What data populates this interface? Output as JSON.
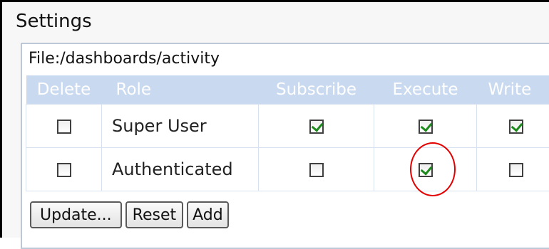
{
  "panel": {
    "title": "Settings"
  },
  "file_path": "File:/dashboards/activity",
  "table": {
    "headers": {
      "delete": "Delete",
      "role": "Role",
      "subscribe": "Subscribe",
      "execute": "Execute",
      "write": "Write"
    },
    "rows": [
      {
        "delete": false,
        "role": "Super User",
        "subscribe": true,
        "execute": true,
        "write": true
      },
      {
        "delete": false,
        "role": "Authenticated",
        "subscribe": false,
        "execute": true,
        "write": false
      }
    ]
  },
  "buttons": {
    "update": "Update...",
    "reset": "Reset",
    "add": "Add"
  },
  "colors": {
    "header_bg": "#c9d9ef",
    "highlight": "#e30000",
    "check": "#1c8a1c"
  }
}
